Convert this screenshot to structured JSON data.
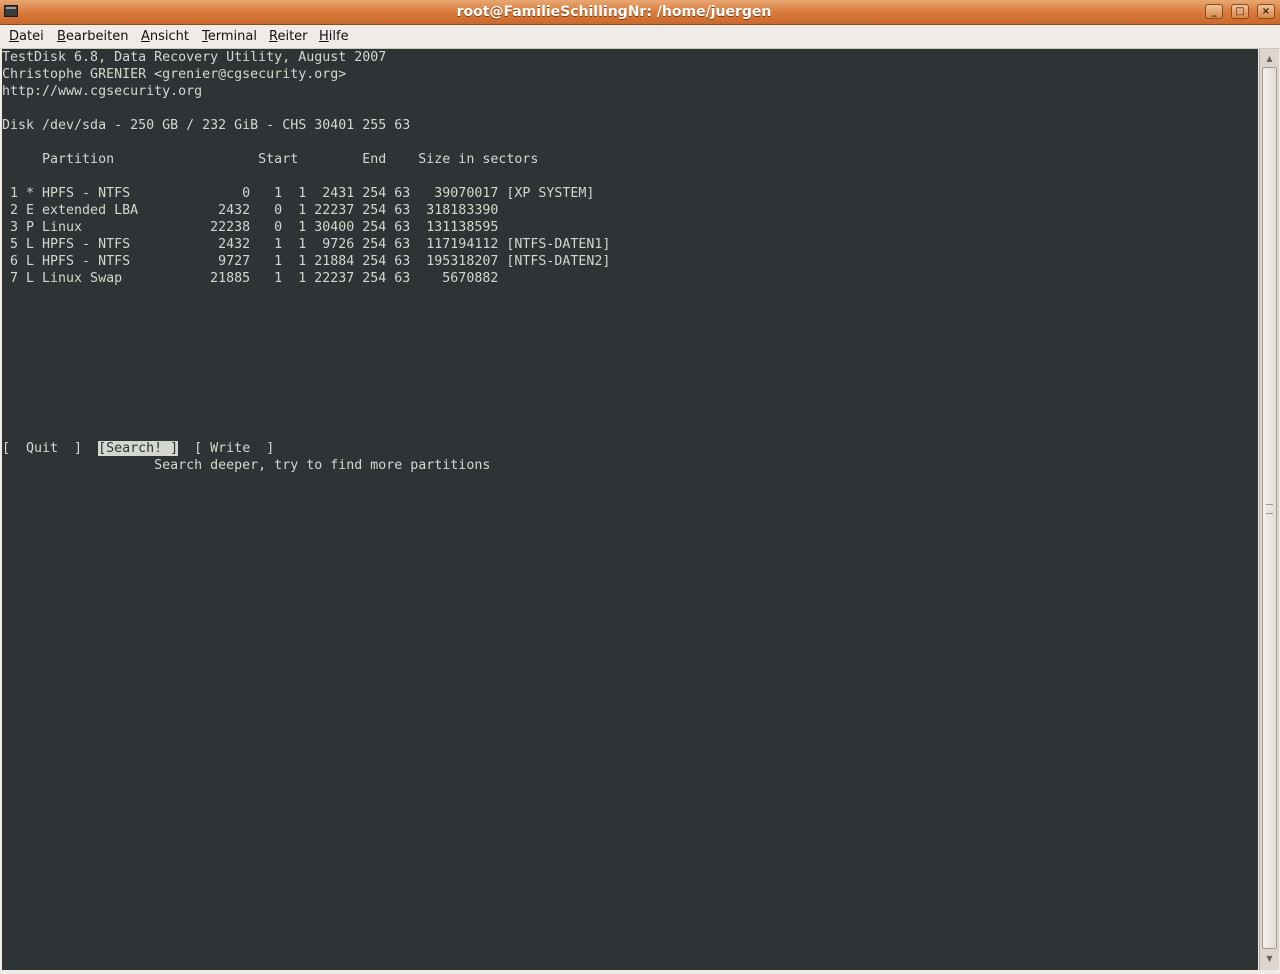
{
  "window": {
    "title": "root@FamilieSchillingNr: /home/juergen",
    "minimize_glyph": "_",
    "maximize_glyph": "□",
    "close_glyph": "×"
  },
  "menu": {
    "items": [
      {
        "accel": "D",
        "rest": "atei"
      },
      {
        "accel": "B",
        "rest": "earbeiten"
      },
      {
        "accel": "A",
        "rest": "nsicht"
      },
      {
        "accel": "T",
        "rest": "erminal"
      },
      {
        "accel": "R",
        "rest": "eiter"
      },
      {
        "accel": "H",
        "rest": "ilfe"
      }
    ]
  },
  "terminal": {
    "header": [
      "TestDisk 6.8, Data Recovery Utility, August 2007",
      "Christophe GRENIER <grenier@cgsecurity.org>",
      "http://www.cgsecurity.org"
    ],
    "disk_line": "Disk /dev/sda - 250 GB / 232 GiB - CHS 30401 255 63",
    "table_header": "     Partition                  Start        End    Size in sectors",
    "partitions": [
      " 1 * HPFS - NTFS              0   1  1  2431 254 63   39070017 [XP SYSTEM]",
      " 2 E extended LBA          2432   0  1 22237 254 63  318183390",
      " 3 P Linux                22238   0  1 30400 254 63  131138595",
      " 5 L HPFS - NTFS           2432   1  1  9726 254 63  117194112 [NTFS-DATEN1]",
      " 6 L HPFS - NTFS           9727   1  1 21884 254 63  195318207 [NTFS-DATEN2]",
      " 7 L Linux Swap           21885   1  1 22237 254 63    5670882"
    ],
    "actions": {
      "quit": "[  Quit  ]",
      "search": "[Search! ]",
      "write": "[ Write  ]"
    },
    "hint": "                   Search deeper, try to find more partitions"
  },
  "colors": {
    "terminal_bg": "#2e3436",
    "terminal_fg": "#d3d7cf",
    "titlebar_accent": "#d97b3c"
  }
}
